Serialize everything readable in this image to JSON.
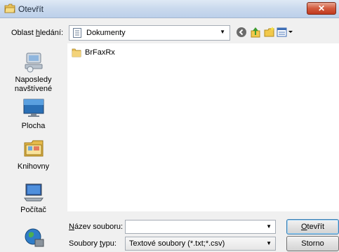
{
  "window": {
    "title": "Otevřít",
    "close_label": "✕"
  },
  "toolbar": {
    "lookin_label_pre": "Oblast ",
    "lookin_label_u": "h",
    "lookin_label_post": "ledání:",
    "lookin_value": "Dokumenty",
    "icons": [
      "back-icon",
      "up-folder-icon",
      "new-folder-icon",
      "view-menu-icon"
    ]
  },
  "places": [
    {
      "label": "Naposledy navštívené",
      "icon": "recent-places-icon"
    },
    {
      "label": "Plocha",
      "icon": "desktop-icon"
    },
    {
      "label": "Knihovny",
      "icon": "libraries-icon"
    },
    {
      "label": "Počítač",
      "icon": "computer-icon"
    },
    {
      "label": "",
      "icon": "network-icon"
    }
  ],
  "files": [
    {
      "name": "BrFaxRx",
      "icon": "folder-icon"
    }
  ],
  "bottom": {
    "filename_label_u": "N",
    "filename_label_rest": "ázev souboru:",
    "filename_value": "",
    "filetype_label_pre": "Soubory ",
    "filetype_label_u": "t",
    "filetype_label_post": "ypu:",
    "filetype_value": "Textové soubory (*.txt;*.csv)",
    "open_label_u": "O",
    "open_label_rest": "tevřít",
    "cancel_label": "Storno"
  }
}
